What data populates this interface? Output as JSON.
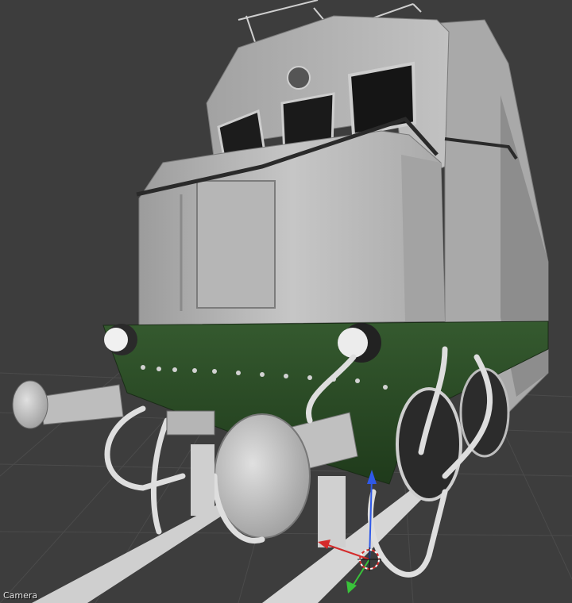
{
  "viewport": {
    "camera_label": "Camera"
  },
  "colors": {
    "background": "#3d3d3d",
    "grid_line": "#4a4a4a",
    "model_body": "#b9b9b9",
    "model_green": "#2b4a26",
    "axis_x": "#d42b2b",
    "axis_y": "#39c33a",
    "axis_z": "#2f59e8"
  },
  "icons": {
    "gizmo": "transform-manipulator-icon",
    "pivot": "3d-cursor-icon"
  }
}
